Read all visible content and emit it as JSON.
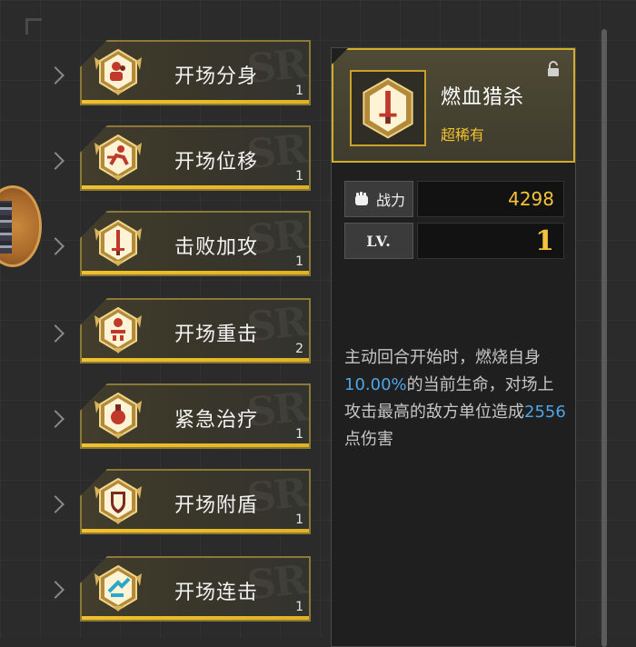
{
  "skills": [
    {
      "name": "开场分身",
      "level": "1",
      "icon": "clone-figure-icon"
    },
    {
      "name": "开场位移",
      "level": "1",
      "icon": "running-figure-icon"
    },
    {
      "name": "击败加攻",
      "level": "1",
      "icon": "sword-icon"
    },
    {
      "name": "开场重击",
      "level": "2",
      "icon": "heavy-strike-icon"
    },
    {
      "name": "紧急治疗",
      "level": "1",
      "icon": "heal-potion-icon"
    },
    {
      "name": "开场附盾",
      "level": "1",
      "icon": "shield-icon"
    },
    {
      "name": "开场连击",
      "level": "1",
      "icon": "combo-strike-icon"
    }
  ],
  "detail": {
    "title": "燃血猎杀",
    "rarity": "超稀有",
    "icon": "blood-sword-icon",
    "power_label": "战力",
    "power_value": "4298",
    "level_label": "LV.",
    "level_value": "1",
    "desc_parts": {
      "p1": "主动回合开始时，燃烧自身",
      "pct": "10.00%",
      "p2": "的当前生命，对场上攻击最高的敌方单位造成",
      "dmg": "2556",
      "p3": "点伤害"
    }
  },
  "colors": {
    "accent_gold": "#f1c12e",
    "highlight_blue": "#4da6e8",
    "panel_bg": "#1f1f1f"
  }
}
